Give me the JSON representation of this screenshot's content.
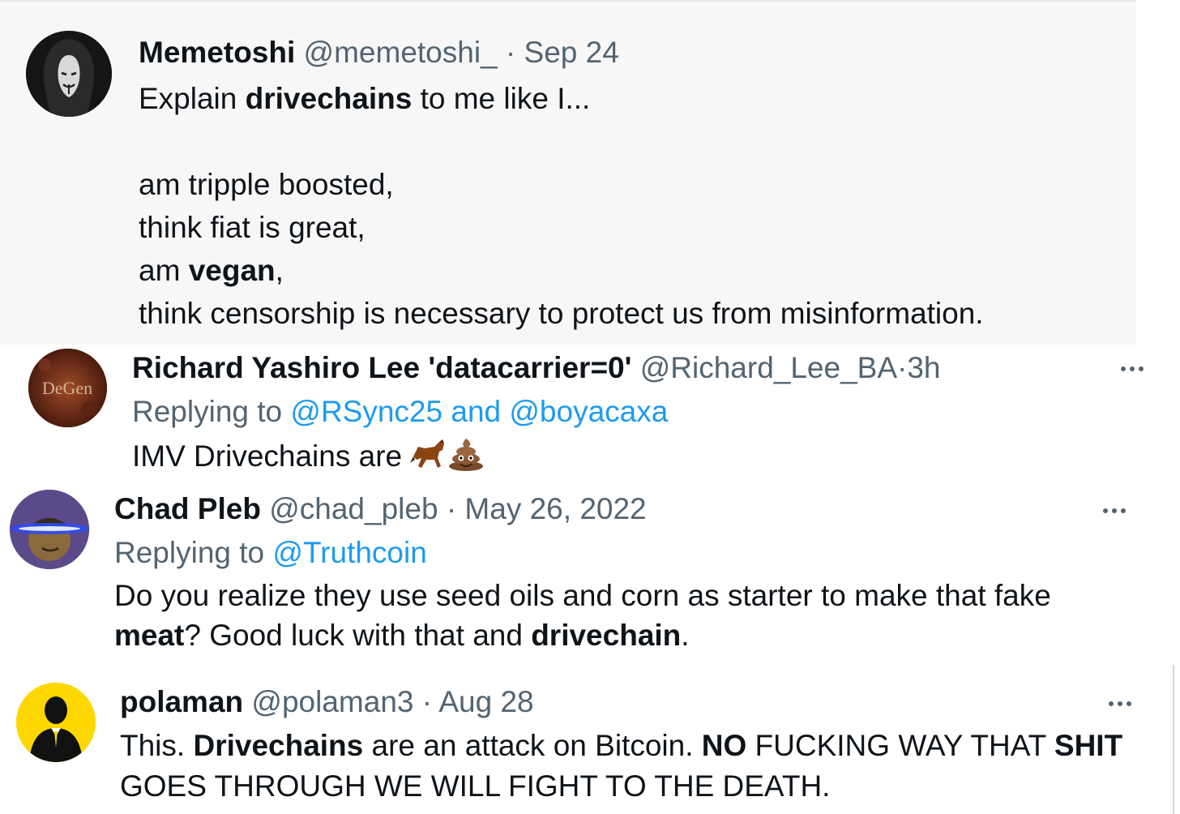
{
  "tweets": [
    {
      "name": "Memetoshi",
      "handle": "@memetoshi_",
      "sep": "·",
      "time": "Sep 24",
      "lines": [
        {
          "a": "Explain ",
          "b": "drivechains",
          "c": " to me like I..."
        },
        {
          "a": "am tripple boosted,"
        },
        {
          "a": "think fiat is great,"
        },
        {
          "a": "am ",
          "b": "vegan",
          "c": ","
        },
        {
          "a": "think censorship is necessary to protect us from misinformation."
        }
      ],
      "avatar_icon": "hooded-mask-avatar-icon"
    },
    {
      "name": "Richard Yashiro Lee 'datacarrier=0'",
      "handle": "@Richard_Lee_BA",
      "sep": "·",
      "time": "3h",
      "reply_label": "Replying to ",
      "reply_targets": "@RSync25 and @boyacaxa",
      "body": "IMV Drivechains are ",
      "emojis": [
        "horse-emoji-icon",
        "poop-emoji-icon"
      ],
      "avatar_icon": "degen-avatar-icon",
      "avatar_text": "DeGen"
    },
    {
      "name": "Chad Pleb",
      "handle": "@chad_pleb",
      "sep": "·",
      "time": "May 26, 2022",
      "reply_label": "Replying to ",
      "reply_targets": "@Truthcoin",
      "line1": "Do you realize they use seed oils and corn as starter to make that fake",
      "line2": {
        "b1": "meat",
        "a1": "? Good luck with that and ",
        "b2": "drivechain",
        "a2": "."
      },
      "avatar_icon": "laser-eyes-avatar-icon"
    },
    {
      "name": "polaman",
      "handle": "@polaman3",
      "sep": "·",
      "time": "Aug 28",
      "line1": {
        "a1": "This. ",
        "b1": "Drivechains",
        "a2": " are an attack on Bitcoin. ",
        "b2": "NO",
        "a3": " FUCKING WAY THAT ",
        "b3": "SHIT"
      },
      "line2": "GOES THROUGH WE WILL FIGHT TO THE DEATH.",
      "avatar_icon": "suit-silhouette-avatar-icon"
    }
  ],
  "colors": {
    "link": "#1d9bf0",
    "meta": "#536471",
    "text": "#0f1419",
    "highlight_bg": "#f7f7f7"
  }
}
